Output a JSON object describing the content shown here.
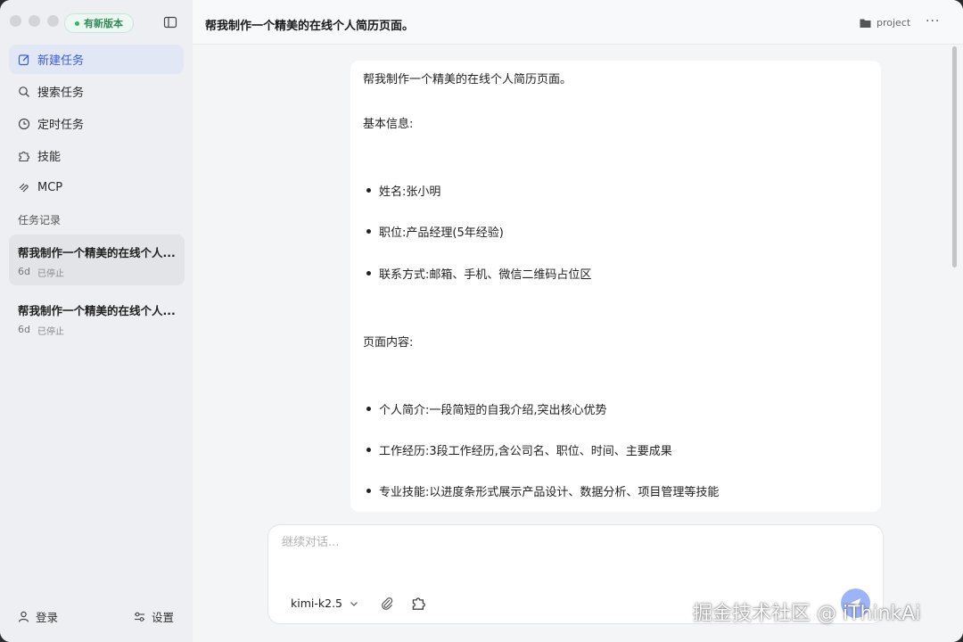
{
  "window": {
    "title": "帮我制作一个精美的在线个人简历页面。"
  },
  "sidebar": {
    "badge": "有新版本",
    "nav": [
      {
        "label": "新建任务",
        "icon": "edit-icon",
        "active": true
      },
      {
        "label": "搜索任务",
        "icon": "search-icon"
      },
      {
        "label": "定时任务",
        "icon": "clock-icon"
      },
      {
        "label": "技能",
        "icon": "puzzle-icon"
      },
      {
        "label": "MCP",
        "icon": "mcp-icon"
      }
    ],
    "section_label": "任务记录",
    "tasks": [
      {
        "title": "帮我制作一个精美的在线个人...",
        "age": "6d",
        "status": "已停止"
      },
      {
        "title": "帮我制作一个精美的在线个人...",
        "age": "6d",
        "status": "已停止"
      }
    ],
    "login": "登录",
    "settings": "设置"
  },
  "topbar": {
    "title": "帮我制作一个精美的在线个人简历页面。",
    "project": "project",
    "more": "···"
  },
  "message": {
    "intro": "帮我制作一个精美的在线个人简历页面。",
    "section1": "基本信息:",
    "bullets1": [
      "姓名:张小明",
      "职位:产品经理(5年经验)",
      "联系方式:邮箱、手机、微信二维码占位区"
    ],
    "section2": "页面内容:",
    "bullets2": [
      "个人简介:一段简短的自我介绍,突出核心优势",
      "工作经历:3段工作经历,含公司名、职位、时间、主要成果",
      "专业技能:以进度条形式展示产品设计、数据分析、项目管理等技能"
    ]
  },
  "composer": {
    "placeholder": "继续对话...",
    "value": "",
    "model": "kimi-k2.5"
  },
  "watermark": "掘金技术社区 @ iThinkAi",
  "colors": {
    "accent": "#3b5bdb",
    "active_bg": "#e1e7f5",
    "badge_green": "#2e8b57",
    "send": "#9db5f7"
  }
}
